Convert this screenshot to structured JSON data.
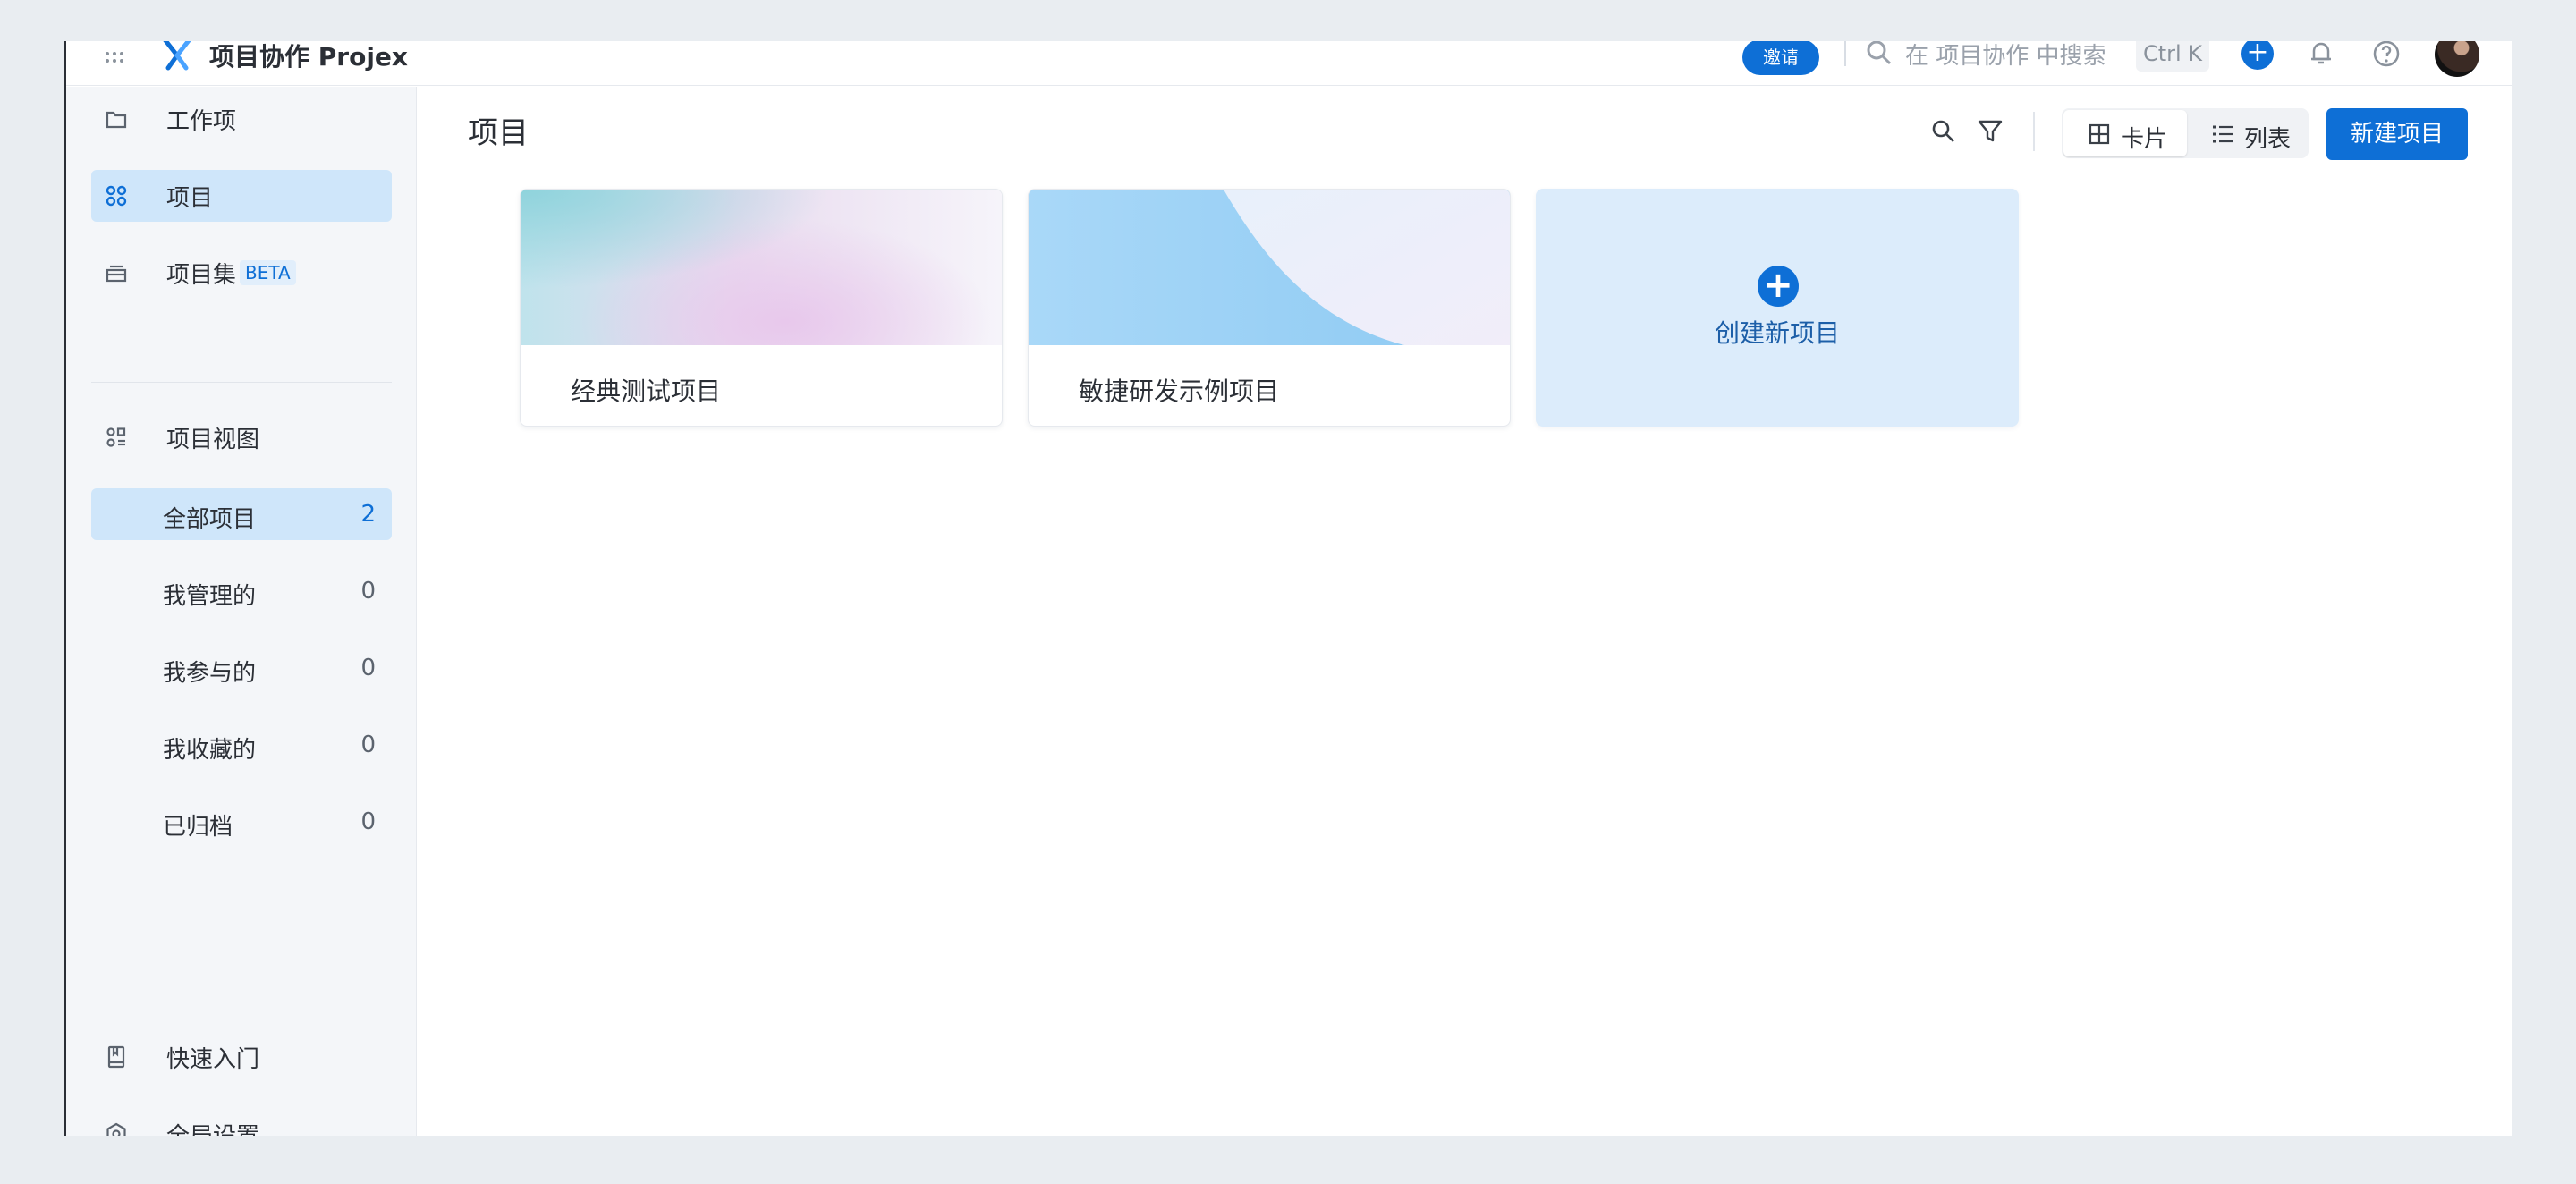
{
  "header": {
    "app_title": "项目协作 Projex",
    "invite_label": "邀请",
    "search_placeholder": "在 项目协作 中搜索",
    "search_shortcut": "Ctrl K",
    "add_label": "+"
  },
  "sidebar": {
    "nav": [
      {
        "label": "工作项",
        "icon": "folder-icon"
      },
      {
        "label": "项目",
        "icon": "project-grid-icon"
      },
      {
        "label": "项目集",
        "icon": "layers-icon",
        "badge": "BETA"
      }
    ],
    "views_title": "项目视图",
    "views": [
      {
        "label": "全部项目",
        "count": "2"
      },
      {
        "label": "我管理的",
        "count": "0"
      },
      {
        "label": "我参与的",
        "count": "0"
      },
      {
        "label": "我收藏的",
        "count": "0"
      },
      {
        "label": "已归档",
        "count": "0"
      }
    ],
    "quick_start": "快速入门",
    "global_settings": "全局设置"
  },
  "main": {
    "title": "项目",
    "toggle_card": "卡片",
    "toggle_list": "列表",
    "new_project": "新建项目",
    "projects": [
      {
        "name": "经典测试项目"
      },
      {
        "name": "敏捷研发示例项目"
      }
    ],
    "create_label": "创建新项目",
    "create_plus": "+"
  },
  "colors": {
    "accent": "#0e6fd6",
    "sidebar_active": "#cfe6fa",
    "highlight": "#f06a0f"
  }
}
